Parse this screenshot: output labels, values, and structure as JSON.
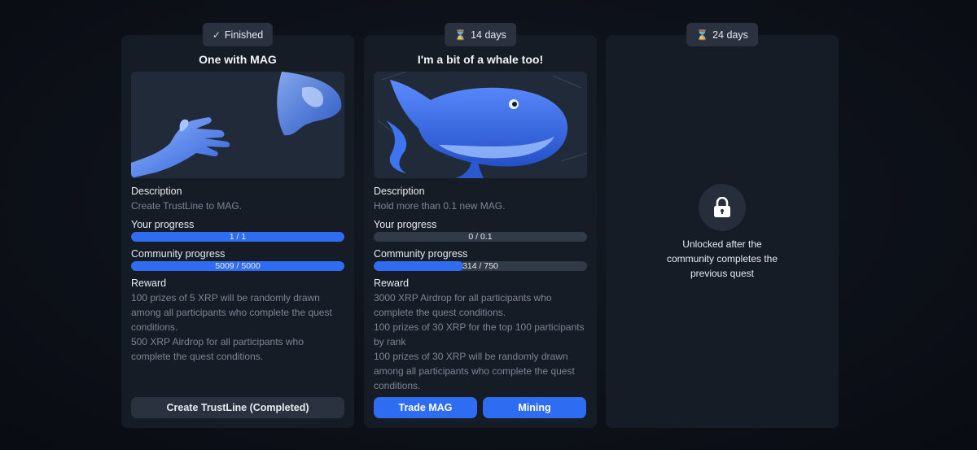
{
  "quests": [
    {
      "badge": {
        "icon": "check-icon",
        "glyph": "✓",
        "label": "Finished"
      },
      "title": "One with MAG",
      "image": "hand-reaching-blue-artwork",
      "description_label": "Description",
      "description": "Create TrustLine to MAG.",
      "your_progress_label": "Your progress",
      "your_progress": {
        "text": "1 / 1",
        "fraction": 1.0
      },
      "community_progress_label": "Community progress",
      "community_progress": {
        "text": "5009 / 5000",
        "fraction": 1.0
      },
      "reward_label": "Reward",
      "reward_lines": [
        "100 prizes of 5 XRP will be randomly drawn",
        "among all participants who complete the quest",
        "conditions.",
        "500 XRP Airdrop for all participants who",
        "complete the quest conditions."
      ],
      "button_label": "Create TrustLine (Completed)"
    },
    {
      "badge": {
        "icon": "hourglass-icon",
        "glyph": "⌛",
        "label": "14 days"
      },
      "title": "I'm a bit of a whale too!",
      "image": "blue-whale-artwork",
      "description_label": "Description",
      "description": "Hold more than 0.1 new MAG.",
      "your_progress_label": "Your progress",
      "your_progress": {
        "text": "0 / 0.1",
        "fraction": 0.0
      },
      "community_progress_label": "Community progress",
      "community_progress": {
        "text": "314 / 750",
        "fraction": 0.4187
      },
      "reward_label": "Reward",
      "reward_lines": [
        "3000 XRP Airdrop for all participants who",
        "complete the quest conditions.",
        "100 prizes of 30 XRP for the top 100 participants",
        "by rank",
        "100 prizes of 30 XRP will be randomly drawn",
        "among all participants who complete the quest",
        "conditions."
      ],
      "buttons": [
        "Trade MAG",
        "Mining"
      ]
    },
    {
      "badge": {
        "icon": "hourglass-icon",
        "glyph": "⌛",
        "label": "24 days"
      },
      "locked_icon": "lock-icon",
      "locked_lines": [
        "Unlocked after the",
        "community completes the",
        "previous quest"
      ]
    }
  ],
  "colors": {
    "accent": "#2e6cf2",
    "card": "#161c26",
    "muted_text": "#7c8594",
    "track": "#313a47"
  }
}
